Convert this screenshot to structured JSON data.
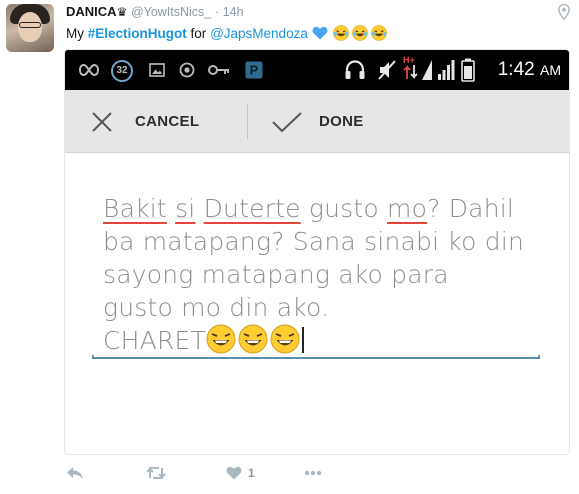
{
  "tweet": {
    "author_name": "DANICA",
    "handle": "@YowItsNics_",
    "separator": "·",
    "time": "14h",
    "text_prefix": "My",
    "hashtag": "#ElectionHugot",
    "text_mid": "for",
    "mention": "@JapsMendoza"
  },
  "phone": {
    "status_bar": {
      "notification_count": "32",
      "network_label": "H+",
      "time": "1:42",
      "ampm": "AM"
    },
    "action_bar": {
      "cancel_label": "CANCEL",
      "done_label": "DONE"
    },
    "note": {
      "line1_w1": "Bakit",
      "line1_w2": "si",
      "line1_w3": "Duterte",
      "line1_w4": "gusto",
      "line1_w5": "mo",
      "line1_w6": "? Dahil",
      "line2": "ba matapang? Sana sinabi ko din",
      "line3": "sayong matapang ako para",
      "line4": "gusto mo din ako.",
      "line5": "CHARET"
    }
  },
  "actions": {
    "like_count": "1"
  },
  "colors": {
    "link": "#1b95e0",
    "heart": "#4aa4f5",
    "spell_underline": "#e0463c",
    "field_line": "#5a8ea8"
  }
}
